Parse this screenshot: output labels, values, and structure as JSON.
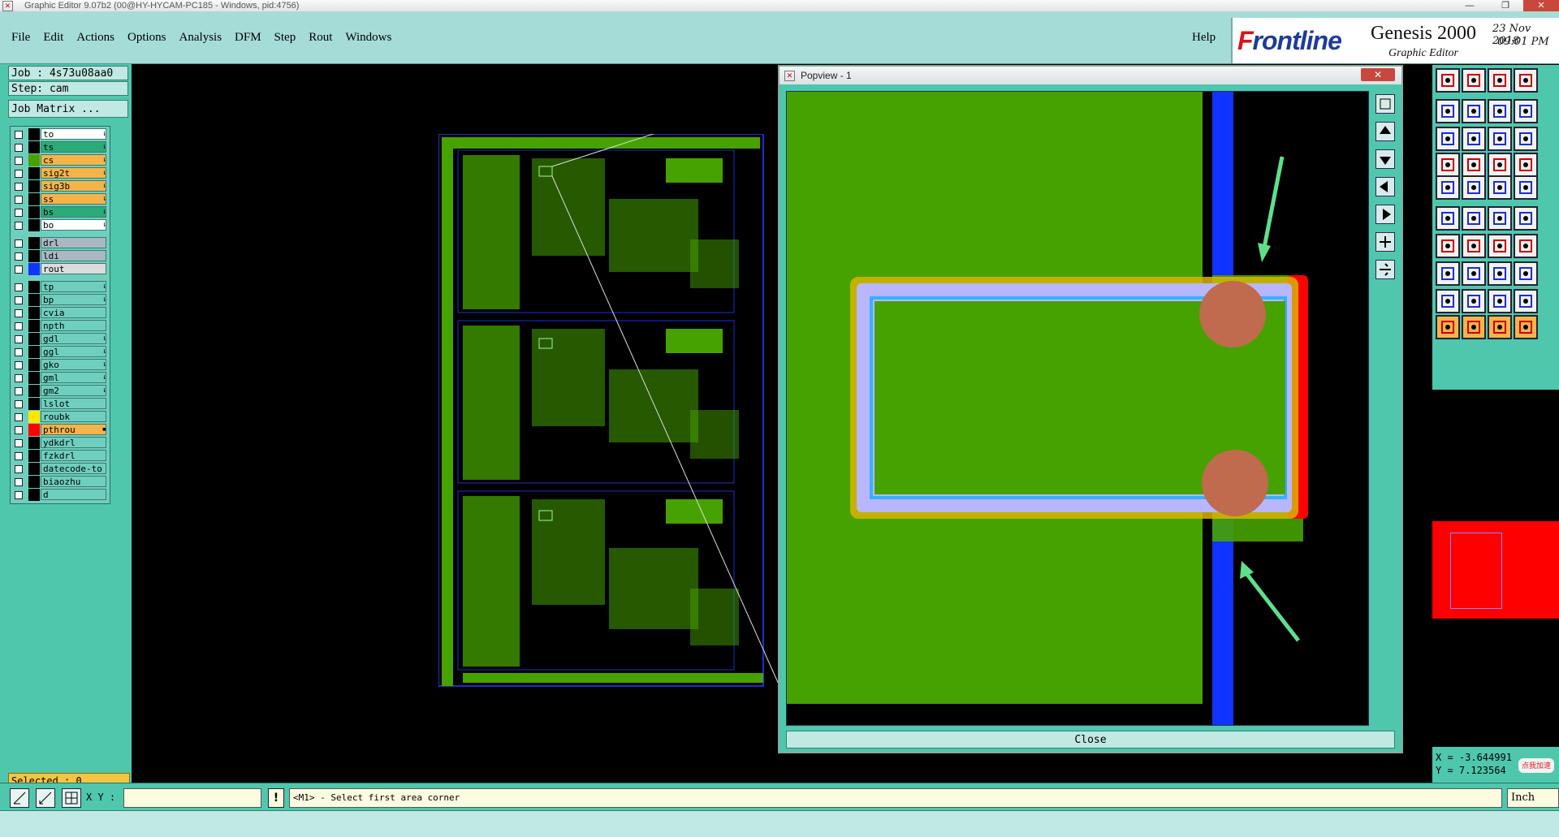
{
  "window": {
    "title": "Graphic Editor 9.07b2 (00@HY-HYCAM-PC185 - Windows, pid:4756)",
    "minimize": "—",
    "maximize": "❐",
    "close": "✕"
  },
  "menubar": {
    "items": [
      "File",
      "Edit",
      "Actions",
      "Options",
      "Analysis",
      "DFM",
      "Step",
      "Rout",
      "Windows"
    ],
    "help": "Help"
  },
  "brand": {
    "logo_f": "F",
    "logo_rest": "rontline",
    "product": "Genesis 2000",
    "subtitle": "Graphic Editor",
    "date": "23 Nov 2018",
    "time": "09:01 PM"
  },
  "left": {
    "job": "Job : 4s73u08aa0",
    "step": "Step: cam",
    "job_matrix": "Job Matrix ...",
    "selected": "Selected : 0",
    "layers_group1": [
      {
        "name": "to",
        "swatch": "#000000",
        "bg": "#ffffff",
        "ic": "⇂"
      },
      {
        "name": "ts",
        "swatch": "#000000",
        "bg": "#2bab78",
        "ic": "⇂"
      },
      {
        "name": "cs",
        "swatch": "#46a200",
        "bg": "#f4b44a",
        "ic": "⇂"
      },
      {
        "name": "sig2t",
        "swatch": "#000000",
        "bg": "#f4b44a",
        "ic": "⇂"
      },
      {
        "name": "sig3b",
        "swatch": "#000000",
        "bg": "#f4b44a",
        "ic": "⇂"
      },
      {
        "name": "ss",
        "swatch": "#000000",
        "bg": "#f4b44a",
        "ic": "⇂"
      },
      {
        "name": "bs",
        "swatch": "#000000",
        "bg": "#2bab78",
        "ic": "⇂"
      },
      {
        "name": "bo",
        "swatch": "#000000",
        "bg": "#ffffff",
        "ic": "⇂"
      }
    ],
    "layers_group2": [
      {
        "name": "drl",
        "swatch": "#000000",
        "bg": "#a9b8c2",
        "ic": ""
      },
      {
        "name": "ldi",
        "swatch": "#000000",
        "bg": "#a9b8c2",
        "ic": ""
      },
      {
        "name": "rout",
        "swatch": "#1133ff",
        "bg": "#dcdcdc",
        "ic": ""
      }
    ],
    "layers_group3": [
      {
        "name": "tp",
        "swatch": "#000000",
        "bg": "#6fcfbe",
        "ic": "⇂"
      },
      {
        "name": "bp",
        "swatch": "#000000",
        "bg": "#6fcfbe",
        "ic": "⇂"
      },
      {
        "name": "cvia",
        "swatch": "#000000",
        "bg": "#6fcfbe",
        "ic": ""
      },
      {
        "name": "npth",
        "swatch": "#000000",
        "bg": "#6fcfbe",
        "ic": ""
      },
      {
        "name": "gdl",
        "swatch": "#000000",
        "bg": "#6fcfbe",
        "ic": "⇂"
      },
      {
        "name": "ggl",
        "swatch": "#000000",
        "bg": "#6fcfbe",
        "ic": "⇂"
      },
      {
        "name": "gko",
        "swatch": "#000000",
        "bg": "#6fcfbe",
        "ic": "⇂"
      },
      {
        "name": "gml",
        "swatch": "#000000",
        "bg": "#6fcfbe",
        "ic": "⇂"
      },
      {
        "name": "gm2",
        "swatch": "#000000",
        "bg": "#6fcfbe",
        "ic": "⇂"
      },
      {
        "name": "lslot",
        "swatch": "#000000",
        "bg": "#6fcfbe",
        "ic": ""
      },
      {
        "name": "roubk",
        "swatch": "#ffe600",
        "bg": "#6fcfbe",
        "ic": ""
      },
      {
        "name": "pthrou",
        "swatch": "#ff0000",
        "bg": "#f4b44a",
        "ic": "▪"
      },
      {
        "name": "ydkdrl",
        "swatch": "#000000",
        "bg": "#6fcfbe",
        "ic": ""
      },
      {
        "name": "fzkdrl",
        "swatch": "#000000",
        "bg": "#6fcfbe",
        "ic": ""
      },
      {
        "name": "datecode-to",
        "swatch": "#000000",
        "bg": "#6fcfbe",
        "ic": ""
      },
      {
        "name": "biaozhu",
        "swatch": "#000000",
        "bg": "#6fcfbe",
        "ic": ""
      },
      {
        "name": "d",
        "swatch": "#000000",
        "bg": "#6fcfbe",
        "ic": ""
      }
    ]
  },
  "popview": {
    "title": "Popview - 1",
    "close_button": "Close",
    "close_x": "✕"
  },
  "coords": {
    "x": "X = -3.644991",
    "y": "Y = 7.123564"
  },
  "bottom": {
    "xy_label": "X Y :",
    "xy_value": "",
    "bang": "!",
    "prompt": "<M1> - Select first area corner",
    "units": "Inch"
  },
  "badge": "点我加速",
  "colors": {
    "panel": "#4fc7ad",
    "menubar": "#a6dcd8",
    "copper": "#46a200",
    "rout": "#1133ff",
    "pthrou": "#ff0000",
    "highlight": "#f4b44a"
  }
}
